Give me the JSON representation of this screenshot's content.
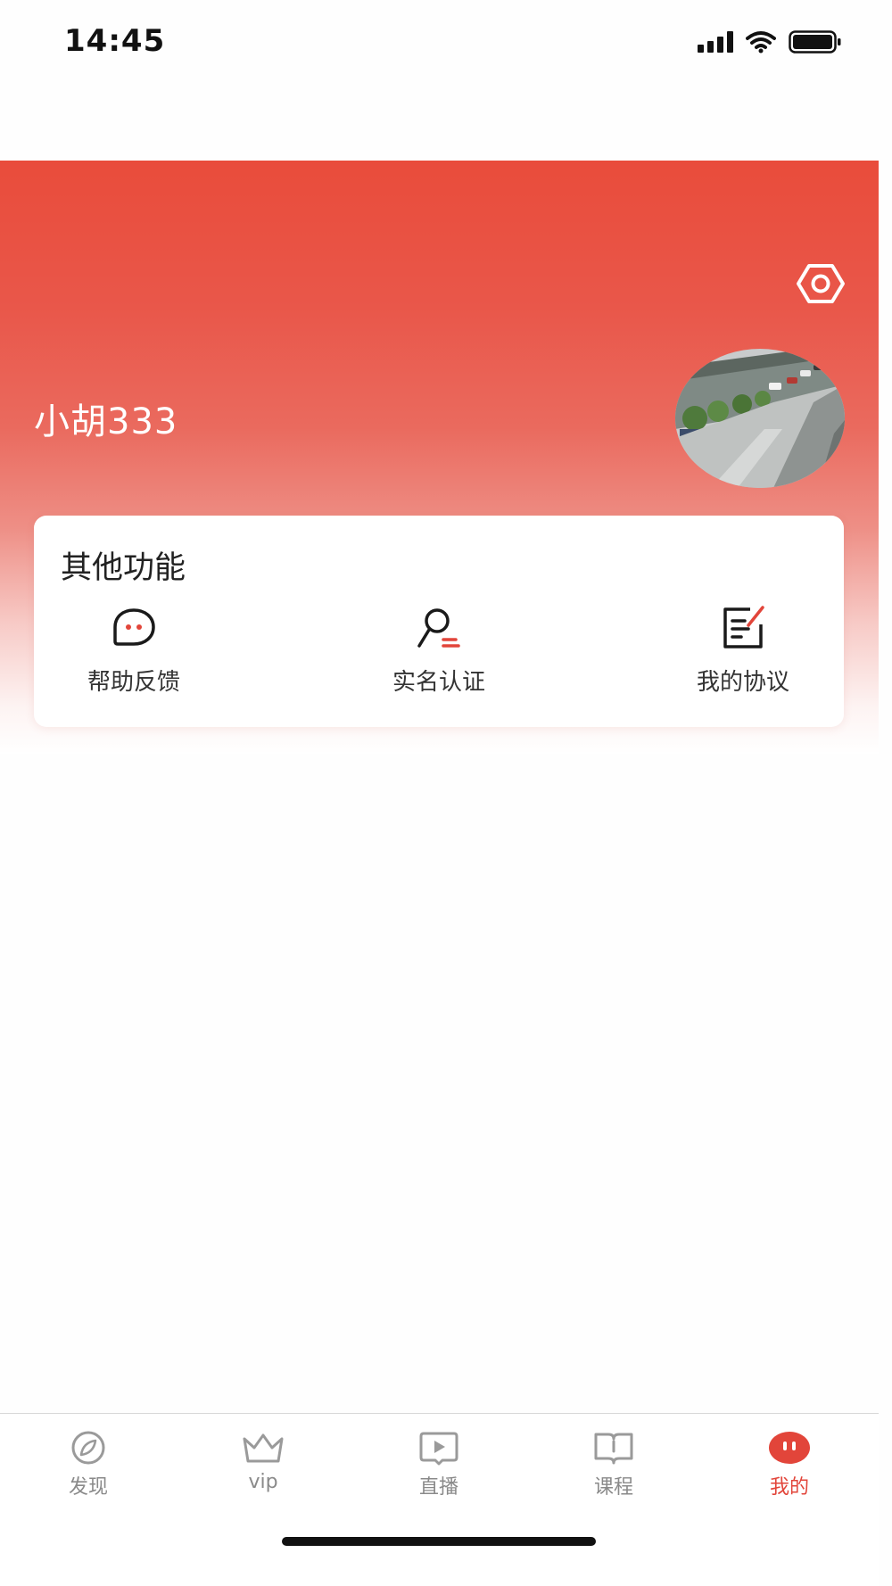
{
  "status_bar": {
    "time": "14:45"
  },
  "profile": {
    "username": "小胡333"
  },
  "other_functions": {
    "title": "其他功能",
    "items": [
      {
        "label": "帮助反馈",
        "icon": "chat-bubble-icon"
      },
      {
        "label": "实名认证",
        "icon": "user-verify-icon"
      },
      {
        "label": "我的协议",
        "icon": "document-edit-icon"
      }
    ]
  },
  "tabbar": {
    "tabs": [
      {
        "label": "发现",
        "icon": "compass-icon",
        "active": false
      },
      {
        "label": "vip",
        "icon": "crown-icon",
        "active": false
      },
      {
        "label": "直播",
        "icon": "play-icon",
        "active": false
      },
      {
        "label": "课程",
        "icon": "book-icon",
        "active": false
      },
      {
        "label": "我的",
        "icon": "profile-face-icon",
        "active": true
      }
    ]
  },
  "colors": {
    "accent": "#e2453a",
    "header_top": "#e94c3b",
    "inactive": "#8a8a8a"
  }
}
